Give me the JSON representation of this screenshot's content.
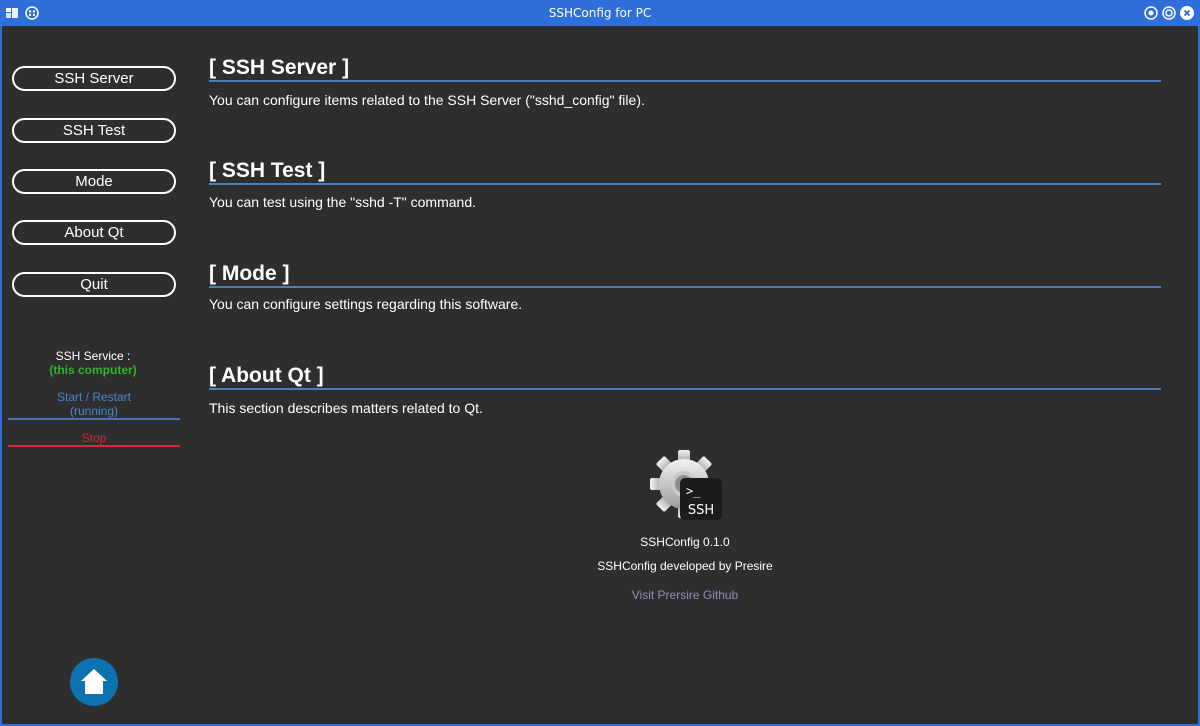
{
  "window": {
    "title": "SSHConfig for PC"
  },
  "sidebar": {
    "buttons": [
      {
        "label": "SSH Server"
      },
      {
        "label": "SSH Test"
      },
      {
        "label": "Mode"
      },
      {
        "label": "About Qt"
      },
      {
        "label": "Quit"
      }
    ],
    "service": {
      "label": "SSH Service :",
      "sublabel": "(this computer)",
      "start_label": "Start / Restart",
      "status": "(running)",
      "stop_label": "Stop"
    }
  },
  "sections": [
    {
      "title": "[ SSH Server ]",
      "description": "You can configure items related to the SSH Server (\"sshd_config\" file)."
    },
    {
      "title": "[ SSH Test ]",
      "description": "You can test using the \"sshd -T\" command."
    },
    {
      "title": "[ Mode ]",
      "description": "You can configure settings regarding this software."
    },
    {
      "title": "[ About Qt ]",
      "description": "This section describes matters related to Qt."
    }
  ],
  "about": {
    "logo_text": "SSH",
    "logo_prompt": ">_",
    "version": "SSHConfig 0.1.0",
    "developer": "SSHConfig developed by Presire",
    "link": "Visit Prersire Github"
  },
  "colors": {
    "titlebar": "#2f6fd9",
    "background": "#2e2e2e",
    "accent_rule": "#4a7fb8",
    "service_ok": "#2fb52f",
    "start": "#4a86c8",
    "stop": "#d8263a",
    "home": "#0d73b0",
    "link": "#8a8fb8"
  }
}
